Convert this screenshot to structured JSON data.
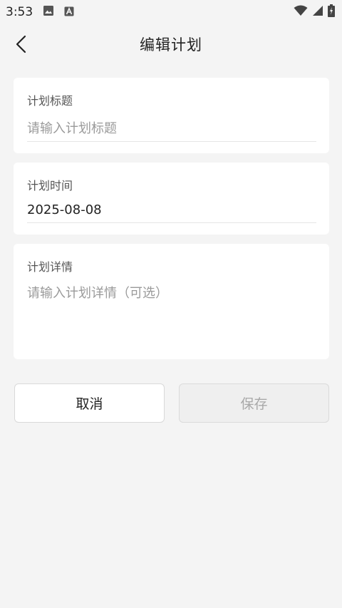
{
  "status_bar": {
    "time": "3:53",
    "icons": [
      "image-icon",
      "a-letter-icon",
      "wifi-icon",
      "signal-icon",
      "battery-icon"
    ]
  },
  "app_bar": {
    "title": "编辑计划",
    "back_icon": "chevron-left-icon"
  },
  "form": {
    "title_card": {
      "label": "计划标题",
      "placeholder": "请输入计划标题",
      "value": ""
    },
    "time_card": {
      "label": "计划时间",
      "value": "2025-08-08"
    },
    "detail_card": {
      "label": "计划详情",
      "placeholder": "请输入计划详情（可选）",
      "value": ""
    }
  },
  "actions": {
    "cancel_label": "取消",
    "save_label": "保存"
  },
  "colors": {
    "background": "#f4f4f4",
    "card": "#ffffff",
    "placeholder_text": "#9a9a9a",
    "disabled_text": "#a8a8a8"
  }
}
